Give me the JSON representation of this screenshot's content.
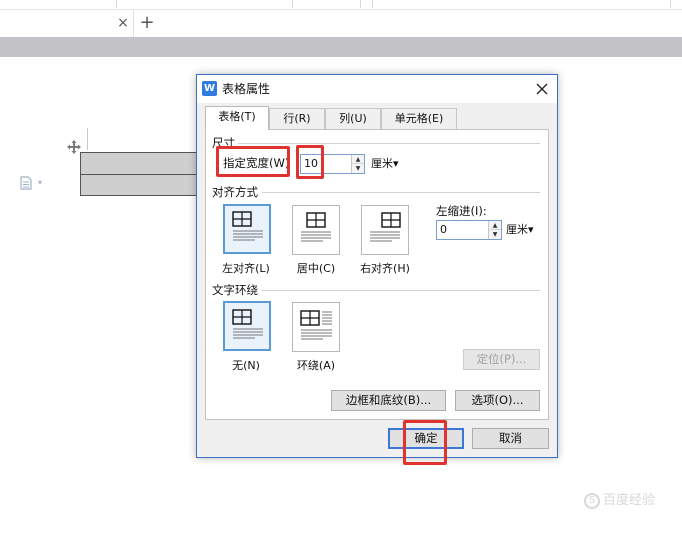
{
  "app": {
    "new_tab_symbol": "+",
    "tab_close_symbol": "×"
  },
  "dialog": {
    "title": "表格属性",
    "tabs": [
      {
        "label": "表格(T)"
      },
      {
        "label": "行(R)"
      },
      {
        "label": "列(U)"
      },
      {
        "label": "单元格(E)"
      }
    ],
    "size": {
      "section_label": "尺寸",
      "width_label": "指定宽度(W)",
      "width_value": "10",
      "unit": "厘米▾"
    },
    "alignment": {
      "section_label": "对齐方式",
      "options": [
        {
          "label": "左对齐(L)",
          "selected": true
        },
        {
          "label": "居中(C)",
          "selected": false
        },
        {
          "label": "右对齐(H)",
          "selected": false
        }
      ],
      "indent_label": "左缩进(I):",
      "indent_value": "0",
      "indent_unit": "厘米▾"
    },
    "wrapping": {
      "section_label": "文字环绕",
      "options": [
        {
          "label": "无(N)",
          "selected": true
        },
        {
          "label": "环绕(A)",
          "selected": false
        }
      ],
      "position_button": "定位(P)..."
    },
    "buttons": {
      "borders_shading": "边框和底纹(B)...",
      "options": "选项(O)...",
      "ok": "确定",
      "cancel": "取消"
    }
  },
  "watermark": {
    "text": "百度经验"
  },
  "colors": {
    "highlight": "#e0332f",
    "accent": "#2f7be0",
    "selected_border": "#5b9bd5"
  },
  "icons": {
    "app": "wps-writer-icon",
    "close": "close-icon",
    "move": "table-move-handle-icon",
    "doc": "document-icon"
  }
}
